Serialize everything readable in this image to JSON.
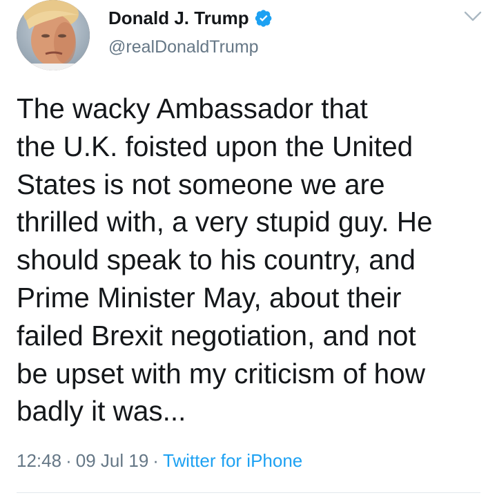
{
  "author": {
    "display_name": "Donald J. Trump",
    "handle": "@realDonaldTrump",
    "verified": true,
    "avatar_icon": "profile-photo"
  },
  "tweet": {
    "lines": [
      "The wacky Ambassador that",
      "the U.K. foisted upon the United",
      "States is not someone we are",
      "thrilled with, a very stupid guy. He",
      "should speak to his country, and",
      "Prime Minister May, about their",
      "failed Brexit negotiation, and not",
      "be upset with my criticism of how",
      "badly it was..."
    ]
  },
  "meta": {
    "time": "12:48",
    "separator": "·",
    "date": "09 Jul 19",
    "source": "Twitter for iPhone"
  },
  "colors": {
    "text": "#14171a",
    "secondary": "#657786",
    "link": "#1da1f2",
    "verified_badge": "#1da1f2",
    "divider": "#e1e8ed"
  }
}
